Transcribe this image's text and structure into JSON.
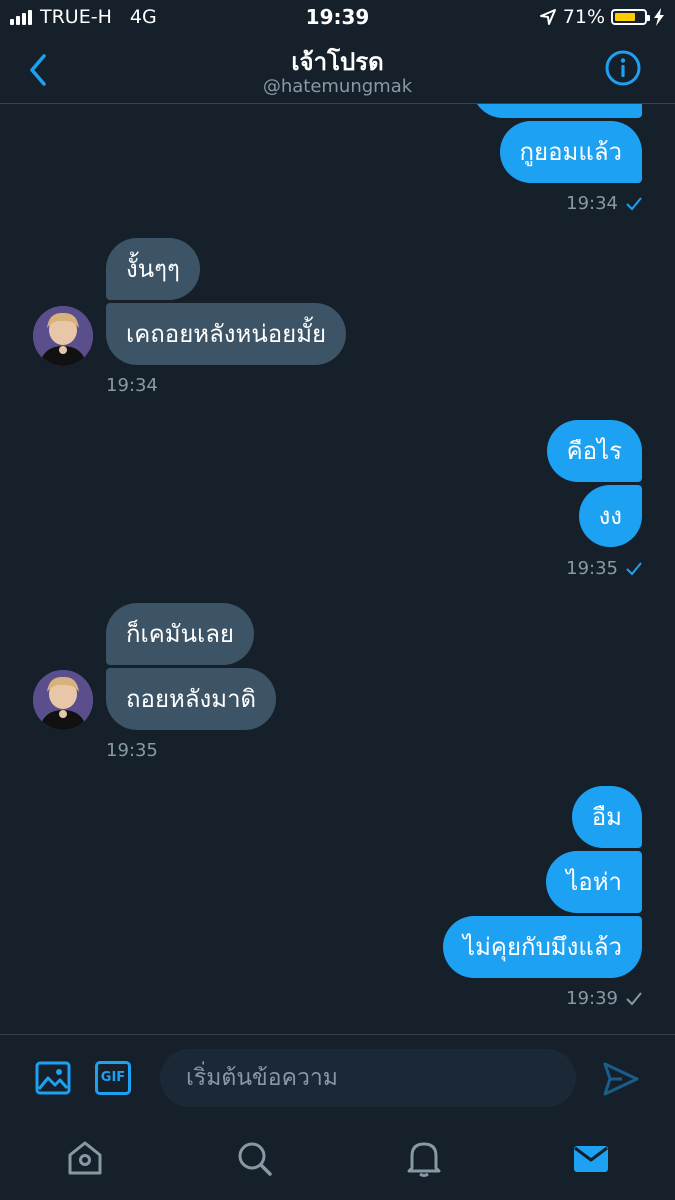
{
  "status_bar": {
    "carrier": "TRUE-H",
    "network": "4G",
    "time": "19:39",
    "battery_percent": "71%",
    "battery_level": 0.71,
    "battery_color": "#ffcc00"
  },
  "header": {
    "title": "เจ้าโปรด",
    "handle": "@hatemungmak",
    "accent_color": "#1da1f2"
  },
  "messages": [
    {
      "direction": "outgoing",
      "text": "กูยอมแล้ว"
    },
    {
      "direction": "outgoing",
      "timestamp": "19:34"
    },
    {
      "direction": "incoming",
      "text": "งั้นๆๆ"
    },
    {
      "direction": "incoming",
      "text": "เคถอยหลังหน่อยมั้ย"
    },
    {
      "direction": "incoming",
      "timestamp": "19:34"
    },
    {
      "direction": "outgoing",
      "text": "คือไร"
    },
    {
      "direction": "outgoing",
      "text": "งง"
    },
    {
      "direction": "outgoing",
      "timestamp": "19:35"
    },
    {
      "direction": "incoming",
      "text": "ก็เคมันเลย"
    },
    {
      "direction": "incoming",
      "text": "ถอยหลังมาดิ"
    },
    {
      "direction": "incoming",
      "timestamp": "19:35"
    },
    {
      "direction": "outgoing",
      "text": "อืม"
    },
    {
      "direction": "outgoing",
      "text": "ไอห่า"
    },
    {
      "direction": "outgoing",
      "text": "ไม่คุยกับมึงแล้ว"
    },
    {
      "direction": "outgoing",
      "timestamp": "19:39"
    }
  ],
  "composer": {
    "placeholder": "เริ่มต้นข้อความ",
    "gif_label": "GIF"
  },
  "tab_bar": {
    "items": [
      "home-icon",
      "search-icon",
      "bell-icon",
      "mail-icon"
    ],
    "active": "mail-icon"
  }
}
